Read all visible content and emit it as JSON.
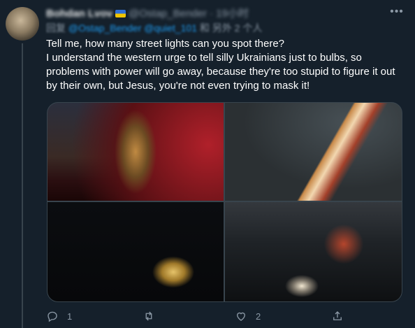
{
  "tweet": {
    "author_name": "Bohdan Lvov",
    "author_meta": "@Ostap_Bender · 19小时",
    "reply_prefix": "回复",
    "reply_handles": "@Ostap_Bender @quiet_101",
    "reply_suffix": "和 另外 2 个人",
    "text_lines": [
      "Tell me, how many street lights can you spot there?",
      "I understand the western urge to tell silly Ukrainians just to bulbs, so problems with power will go away, because they're too stupid to figure it out by their own, but Jesus, you're not even trying to mask it!"
    ],
    "images": [
      "night-church",
      "night-highway",
      "dark-kiosk",
      "people-in-dark-street"
    ]
  },
  "actions": {
    "reply_count": "1",
    "retweet_count": "",
    "like_count": "2",
    "share_count": ""
  },
  "icons": {
    "more": "more-icon",
    "reply": "reply-icon",
    "retweet": "retweet-icon",
    "like": "heart-icon",
    "share": "share-icon"
  },
  "colors": {
    "background": "#15202b",
    "text": "#ffffff",
    "muted": "#8b98a5",
    "link": "#1d9bf0",
    "border": "#38444d"
  }
}
